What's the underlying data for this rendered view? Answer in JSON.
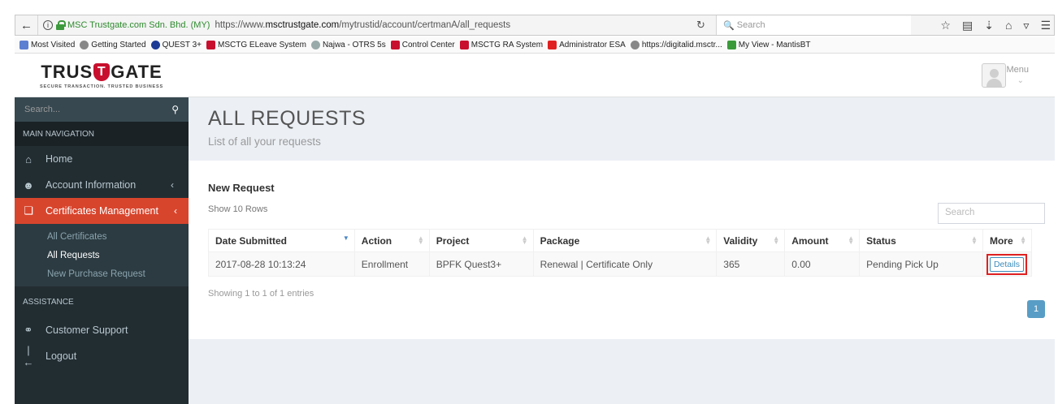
{
  "browser": {
    "org": "MSC Trustgate.com Sdn. Bhd. (MY)",
    "url_prefix": "https://www.",
    "url_domain": "msctrustgate.com",
    "url_path": "/mytrustid/account/certmanA/all_requests",
    "search_placeholder": "Search",
    "bookmarks": [
      "Most Visited",
      "Getting Started",
      "QUEST 3+",
      "MSCTG ELeave System",
      "Najwa - OTRS 5s",
      "Control Center",
      "MSCTG RA System",
      "Administrator ESA",
      "https://digitalid.msctr...",
      "My View - MantisBT"
    ]
  },
  "logo": {
    "pre": "TRUS",
    "t": "T",
    "post": "GATE",
    "tagline": "SECURE TRANSACTION. TRUSTED BUSINESS"
  },
  "sidebar": {
    "search_placeholder": "Search...",
    "main_header": "MAIN NAVIGATION",
    "items": [
      {
        "label": "Home",
        "icon": "home-icon"
      },
      {
        "label": "Account Information",
        "icon": "user-icon"
      },
      {
        "label": "Certificates Management",
        "icon": "certificates-icon"
      }
    ],
    "sub_items": [
      "All Certificates",
      "All Requests",
      "New Purchase Request"
    ],
    "assist_header": "ASSISTANCE",
    "assist_items": [
      {
        "label": "Customer Support",
        "icon": "headset-icon"
      },
      {
        "label": "Logout",
        "icon": "logout-icon"
      }
    ]
  },
  "topnav": {
    "menu_label": "Menu"
  },
  "header": {
    "title": "ALL REQUESTS",
    "subtitle": "List of all your requests"
  },
  "panel": {
    "title": "New Request",
    "show_rows": "Show 10 Rows",
    "search_placeholder": "Search",
    "columns": [
      "Date Submitted",
      "Action",
      "Project",
      "Package",
      "Validity",
      "Amount",
      "Status",
      "More"
    ],
    "rows": [
      {
        "date": "2017-08-28 10:13:24",
        "action": "Enrollment",
        "project": "BPFK Quest3+",
        "package": "Renewal | Certificate Only",
        "validity": "365",
        "amount": "0.00",
        "status": "Pending Pick Up",
        "more": "Details"
      }
    ],
    "showing": "Showing 1 to 1 of 1 entries",
    "page": "1"
  }
}
